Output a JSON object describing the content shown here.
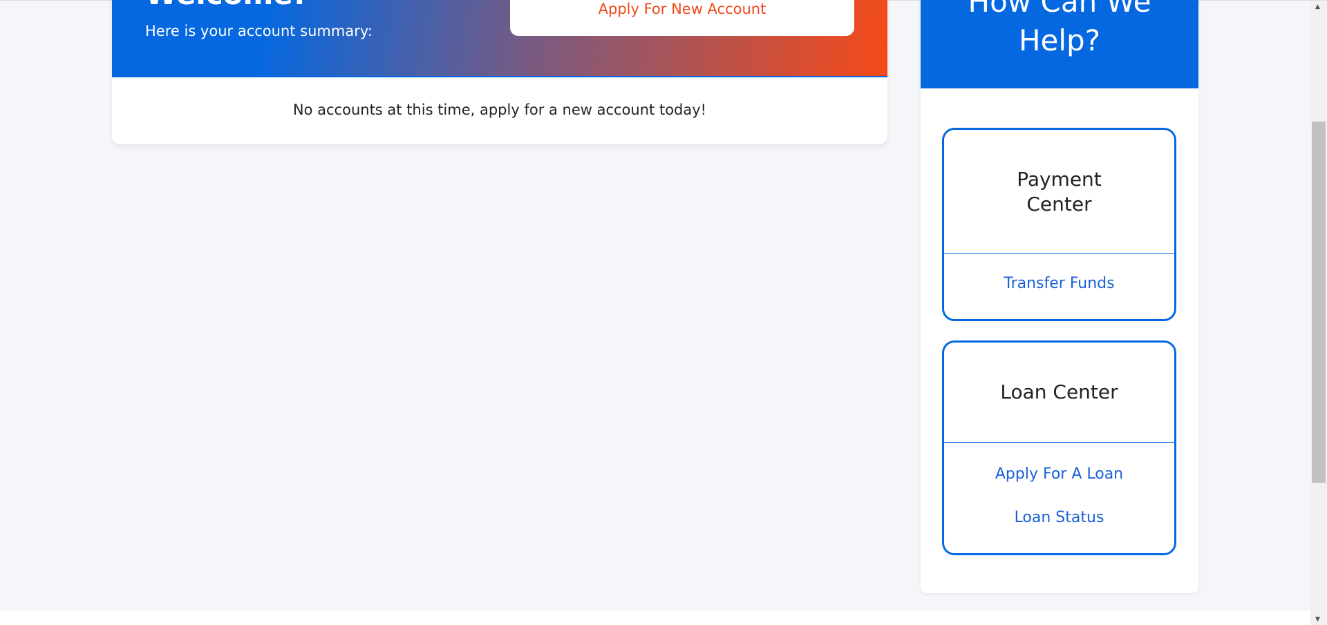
{
  "account": {
    "welcome": "Welcome!",
    "summary": "Here is your account summary:",
    "apply_button": "Apply For New Account",
    "empty_message": "No accounts at this time, apply for a new account today!"
  },
  "help": {
    "title_line1": "How Can We",
    "title_line2": "Help?",
    "payment": {
      "title": "Payment Center",
      "links": [
        "Transfer Funds"
      ]
    },
    "loan": {
      "title": "Loan Center",
      "links": [
        "Apply For A Loan",
        "Loan Status"
      ]
    }
  },
  "colors": {
    "brand_blue": "#0568e0",
    "accent_orange": "#f64a18"
  }
}
